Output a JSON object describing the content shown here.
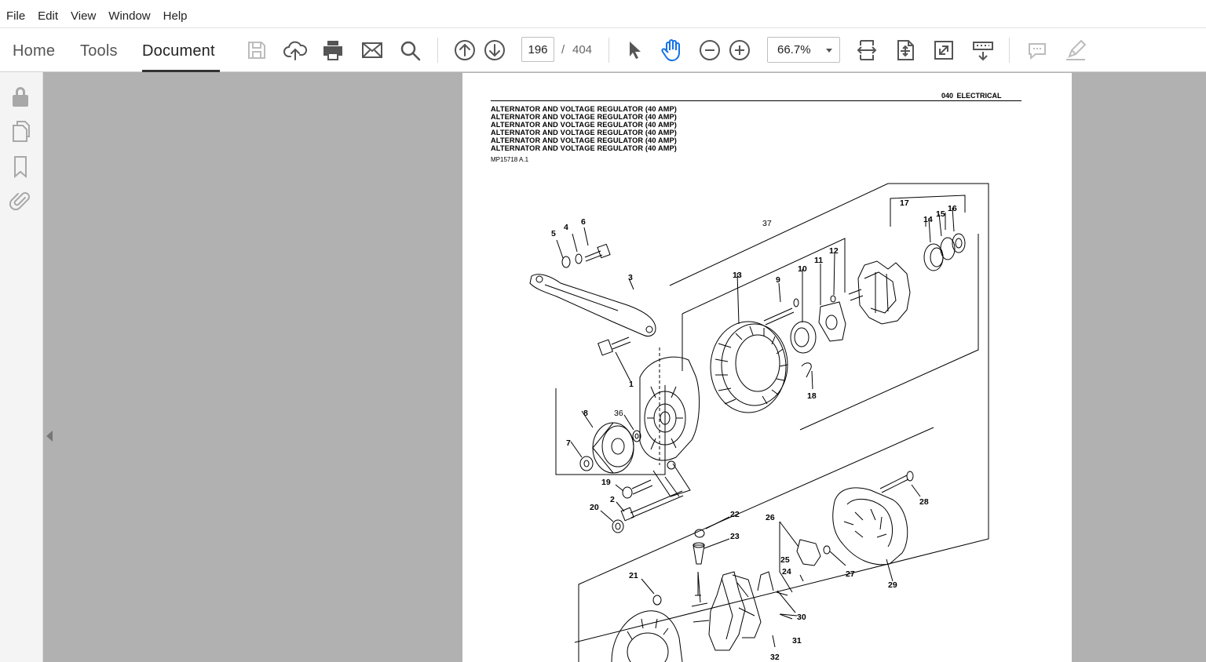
{
  "menubar": {
    "items": [
      "File",
      "Edit",
      "View",
      "Window",
      "Help"
    ]
  },
  "toolbar": {
    "tabs": [
      "Home",
      "Tools",
      "Document"
    ],
    "active_tab": "Document",
    "icons": [
      "save-icon",
      "upload-cloud-icon",
      "print-icon",
      "email-icon",
      "search-icon",
      "page-up-icon",
      "page-down-icon",
      "select-cursor-icon",
      "hand-tool-icon",
      "zoom-out-icon",
      "zoom-in-icon",
      "fit-width-icon",
      "fit-page-icon",
      "full-screen-icon",
      "scroll-mode-icon",
      "comment-icon",
      "highlight-pen-icon"
    ],
    "page_current": "196",
    "page_separator": "/",
    "page_total": "404",
    "zoom_value": "66.7%",
    "hand_tool_color": "#1473e6"
  },
  "left_panel": {
    "icons": [
      "lock-icon",
      "pages-icon",
      "bookmark-icon",
      "attachment-icon"
    ]
  },
  "document": {
    "section": "040  ELECTRICAL",
    "titles": [
      "ALTERNATOR AND VOLTAGE REGULATOR (40 AMP)",
      "ALTERNATOR AND VOLTAGE REGULATOR (40 AMP)",
      "ALTERNATOR AND VOLTAGE REGULATOR (40 AMP)",
      "ALTERNATOR AND VOLTAGE REGULATOR (40 AMP)",
      "ALTERNATOR AND VOLTAGE REGULATOR (40 AMP)",
      "ALTERNATOR AND VOLTAGE REGULATOR (40 AMP)"
    ],
    "ref_code": "MP15718 A.1",
    "callouts": {
      "c1": "1",
      "c2": "2",
      "c3": "3",
      "c4": "4",
      "c5": "5",
      "c6": "6",
      "c7": "7",
      "c8": "8",
      "c9": "9",
      "c10": "10",
      "c11": "11",
      "c12": "12",
      "c13": "13",
      "c14": "14",
      "c15": "15",
      "c16": "16",
      "c17": "17",
      "c18": "18",
      "c19": "19",
      "c20": "20",
      "c21": "21",
      "c22": "22",
      "c23": "23",
      "c24": "24",
      "c25": "25",
      "c26": "26",
      "c27": "27",
      "c28": "28",
      "c29": "29",
      "c30": "30",
      "c31": "31",
      "c32": "32",
      "c36": "36",
      "c37": "37"
    }
  }
}
